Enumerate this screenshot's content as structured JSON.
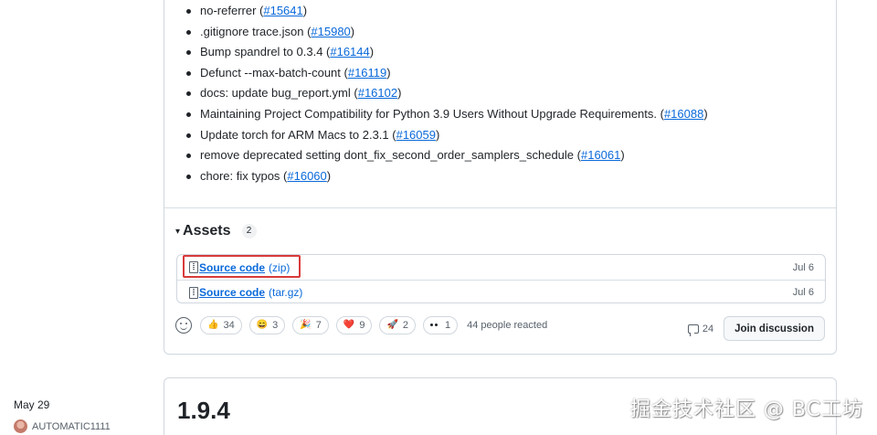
{
  "release_notes": {
    "items": [
      {
        "text": "no-referrer (",
        "pr": "#15641",
        "end": ")"
      },
      {
        "text": ".gitignore trace.json (",
        "pr": "#15980",
        "end": ")"
      },
      {
        "text": "Bump spandrel to 0.3.4 (",
        "pr": "#16144",
        "end": ")"
      },
      {
        "text": "Defunct --max-batch-count (",
        "pr": "#16119",
        "end": ")"
      },
      {
        "text": "docs: update bug_report.yml (",
        "pr": "#16102",
        "end": ")"
      },
      {
        "text": "Maintaining Project Compatibility for Python 3.9 Users Without Upgrade Requirements. (",
        "pr": "#16088",
        "end": ")"
      },
      {
        "text": "Update torch for ARM Macs to 2.3.1 (",
        "pr": "#16059",
        "end": ")"
      },
      {
        "text": "remove deprecated setting dont_fix_second_order_samplers_schedule (",
        "pr": "#16061",
        "end": ")"
      },
      {
        "text": "chore: fix typos (",
        "pr": "#16060",
        "end": ")"
      }
    ]
  },
  "assets": {
    "caret": "▾",
    "title": "Assets",
    "count": "2",
    "files": [
      {
        "name": "Source code",
        "ext": "(zip)",
        "date": "Jul 6"
      },
      {
        "name": "Source code",
        "ext": "(tar.gz)",
        "date": "Jul 6"
      }
    ]
  },
  "reactions": {
    "items": [
      {
        "emoji": "👍",
        "icon": "thumbs-up-icon",
        "count": "34"
      },
      {
        "emoji": "😄",
        "icon": "laugh-icon",
        "count": "3"
      },
      {
        "emoji": "🎉",
        "icon": "hooray-icon",
        "count": "7"
      },
      {
        "emoji": "❤️",
        "icon": "heart-icon",
        "count": "9"
      },
      {
        "emoji": "🚀",
        "icon": "rocket-icon",
        "count": "2"
      },
      {
        "emoji": "",
        "icon": "eyes-icon",
        "count": "1"
      }
    ],
    "summary": "44 people reacted"
  },
  "discussion": {
    "count": "24",
    "button_label": "Join discussion"
  },
  "next_release": {
    "version": "1.9.4",
    "date": "May 29",
    "author": "AUTOMATIC1111"
  },
  "watermark": "掘金技术社区 @ BC工坊",
  "colors": {
    "link": "#0969da",
    "border": "#d0d7de",
    "highlight": "#d93a3a",
    "muted_text": "#57606a"
  }
}
